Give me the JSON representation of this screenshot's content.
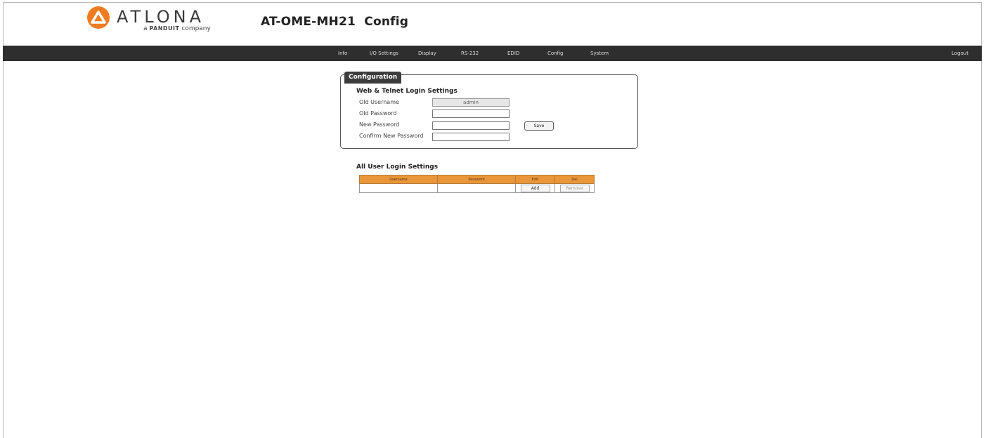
{
  "brand": {
    "wordmark": "ATLONA",
    "tagline_prefix": "a",
    "tagline_brand": "PANDUIT",
    "tagline_suffix": "company",
    "accent_color": "#f07c22"
  },
  "header": {
    "title": "AT-OME-MH21  Config"
  },
  "nav": {
    "items": [
      "Info",
      "I/O Settings",
      "Display",
      "RS-232",
      "EDID",
      "Config",
      "System"
    ],
    "logout": "Logout"
  },
  "config_panel": {
    "tab_label": "Configuration",
    "section_title": "Web & Telnet Login Settings",
    "fields": [
      {
        "label": "Old Username",
        "value": "admin"
      },
      {
        "label": "Old Password",
        "value": ""
      },
      {
        "label": "New Password",
        "value": ""
      },
      {
        "label": "Confirm New Password",
        "value": ""
      }
    ],
    "save_label": "Save"
  },
  "user_settings": {
    "title": "All User Login Settings",
    "columns": [
      "Username",
      "Password",
      "Edit",
      "Del"
    ],
    "row": {
      "username": "",
      "password": "",
      "edit_label": "Add",
      "del_label": "Remove"
    },
    "header_color": "#e9963b"
  }
}
